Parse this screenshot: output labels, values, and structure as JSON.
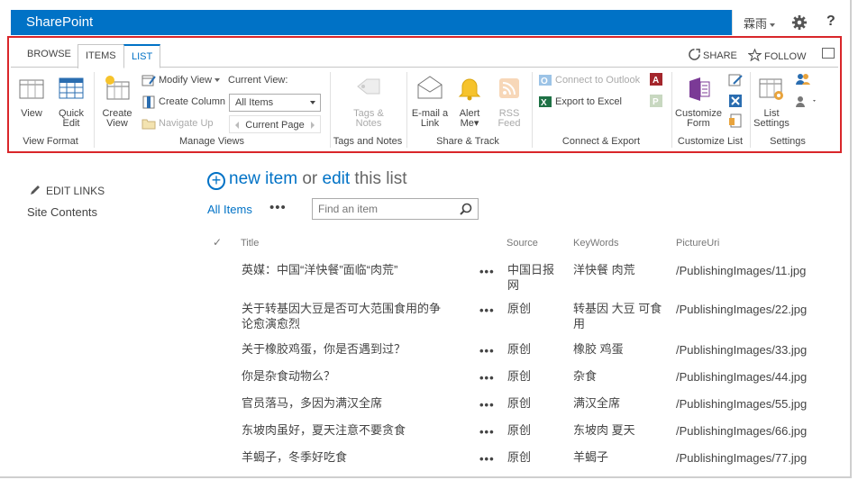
{
  "suitebar": {
    "brand": "SharePoint",
    "user": "霖雨",
    "help": "?"
  },
  "ribbon_tabs": {
    "browse": "BROWSE",
    "items": "ITEMS",
    "list": "LIST",
    "share": "SHARE",
    "follow": "FOLLOW"
  },
  "ribbon": {
    "view_format": {
      "label": "View Format",
      "view": "View",
      "quick_edit_1": "Quick",
      "quick_edit_2": "Edit"
    },
    "manage_views": {
      "label": "Manage Views",
      "create_view_1": "Create",
      "create_view_2": "View",
      "modify_view": "Modify View",
      "create_column": "Create Column",
      "navigate_up": "Navigate Up",
      "current_view_label": "Current View:",
      "current_view_value": "All Items",
      "current_page": "Current Page"
    },
    "tags_notes": {
      "label": "Tags and Notes",
      "btn_1": "Tags &",
      "btn_2": "Notes"
    },
    "share_track": {
      "label": "Share & Track",
      "email_1": "E-mail a",
      "email_2": "Link",
      "alert_1": "Alert",
      "alert_2": "Me",
      "rss_1": "RSS",
      "rss_2": "Feed"
    },
    "connect_export": {
      "label": "Connect & Export",
      "outlook": "Connect to Outlook",
      "excel": "Export to Excel"
    },
    "customize_list": {
      "label": "Customize List",
      "customize_form_1": "Customize",
      "customize_form_2": "Form"
    },
    "settings": {
      "label": "Settings",
      "list_settings_1": "List",
      "list_settings_2": "Settings"
    }
  },
  "left_nav": {
    "edit_links": "EDIT LINKS",
    "site_contents": "Site Contents"
  },
  "main": {
    "new_item": "new item",
    "or": "or",
    "edit": "edit",
    "this_list": "this list",
    "view_all_items": "All Items",
    "view_more": "•••",
    "search_placeholder": "Find an item"
  },
  "table": {
    "check_header": "✓",
    "headers": {
      "title": "Title",
      "source": "Source",
      "keywords": "KeyWords",
      "picture": "PictureUri"
    },
    "rows": [
      {
        "title": "英媒：中国“洋快餐”面临“肉荒”",
        "dots": "•••",
        "source": "中国日报网",
        "keywords": "洋快餐 肉荒",
        "picture": "/PublishingImages/11.jpg"
      },
      {
        "title": "关于转基因大豆是否可大范围食用的争论愈演愈烈",
        "dots": "•••",
        "source": "原创",
        "keywords": "转基因 大豆 可食用",
        "picture": "/PublishingImages/22.jpg"
      },
      {
        "title": "关于橡胶鸡蛋，你是否遇到过？",
        "dots": "•••",
        "source": "原创",
        "keywords": "橡胶 鸡蛋",
        "picture": "/PublishingImages/33.jpg"
      },
      {
        "title": "你是杂食动物么？",
        "dots": "•••",
        "source": "原创",
        "keywords": "杂食",
        "picture": "/PublishingImages/44.jpg"
      },
      {
        "title": "官员落马，多因为满汉全席",
        "dots": "•••",
        "source": "原创",
        "keywords": "满汉全席",
        "picture": "/PublishingImages/55.jpg"
      },
      {
        "title": "东坡肉虽好，夏天注意不要贪食",
        "dots": "•••",
        "source": "原创",
        "keywords": "东坡肉 夏天",
        "picture": "/PublishingImages/66.jpg"
      },
      {
        "title": "羊蝎子，冬季好吃食",
        "dots": "•••",
        "source": "原创",
        "keywords": "羊蝎子",
        "picture": "/PublishingImages/77.jpg"
      }
    ]
  },
  "colors": {
    "accent": "#0072c6",
    "highlight_border": "#d9262a"
  }
}
